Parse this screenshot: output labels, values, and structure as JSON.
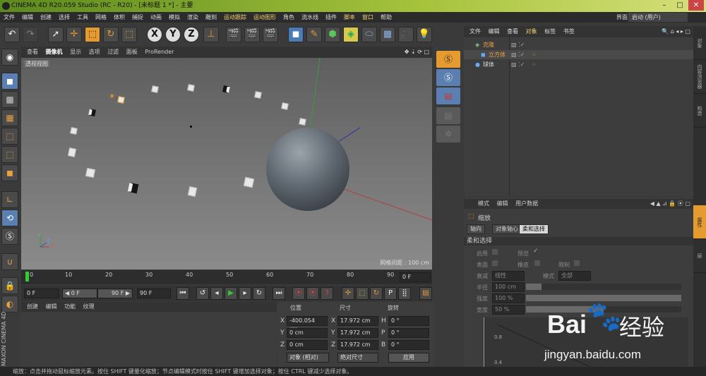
{
  "titlebar": {
    "title": "CINEMA 4D R20.059 Studio (RC - R20) - [未标题 1 *] - 主要",
    "min": "–",
    "max": "□",
    "close": "✕"
  },
  "menu": {
    "items": [
      "文件",
      "编辑",
      "创建",
      "选择",
      "工具",
      "网格",
      "体积",
      "捕捉",
      "动画",
      "模拟",
      "渲染",
      "雕刻",
      "运动跟踪",
      "运动图形",
      "角色",
      "流水线",
      "插件",
      "脚本",
      "窗口",
      "帮助"
    ],
    "layout_label": "界面:",
    "layout_value": "启动 (用户)"
  },
  "toolbar": {
    "x": "X",
    "y": "Y",
    "z": "Z"
  },
  "viewport": {
    "tabs": [
      "查看",
      "摄像机",
      "显示",
      "选项",
      "过滤",
      "面板",
      "ProRender"
    ],
    "label": "透视视图",
    "grid_info": "网格间距 : 100 cm",
    "axis_y": "Y",
    "axis_x": "X",
    "axis_z": "Z"
  },
  "timeline": {
    "ticks": [
      "0",
      "10",
      "20",
      "30",
      "40",
      "50",
      "60",
      "70",
      "80",
      "90"
    ],
    "frame": "0 F"
  },
  "playback": {
    "start": "0 F",
    "current": "◀ 0 F",
    "end_inner": "90 F ▶",
    "end": "90 F"
  },
  "bottom_left": {
    "tabs": [
      "创建",
      "编辑",
      "功能",
      "纹理"
    ]
  },
  "coords": {
    "headers": [
      "位置",
      "尺寸",
      "旋转"
    ],
    "rows": [
      {
        "axis": "X",
        "pos": "-400.054 cm",
        "size_axis": "X",
        "size": "17.972 cm",
        "rot_axis": "H",
        "rot": "0 °"
      },
      {
        "axis": "Y",
        "pos": "0 cm",
        "size_axis": "Y",
        "size": "17.972 cm",
        "rot_axis": "P",
        "rot": "0 °"
      },
      {
        "axis": "Z",
        "pos": "0 cm",
        "size_axis": "Z",
        "size": "17.972 cm",
        "rot_axis": "B",
        "rot": "0 °"
      }
    ],
    "mode": "对象 (相对)",
    "size_mode": "绝对尺寸",
    "apply": "应用"
  },
  "objects": {
    "tabs": [
      "文件",
      "编辑",
      "查看",
      "对象",
      "标签",
      "书签"
    ],
    "items": [
      {
        "name": "克隆"
      },
      {
        "name": "立方体"
      },
      {
        "name": "球体"
      }
    ]
  },
  "attributes": {
    "tabs": [
      "模式",
      "编辑",
      "用户数据"
    ],
    "object_name": "缩放",
    "subtabs": [
      "轴向",
      "对象轴心",
      "柔和选择"
    ],
    "section": "柔和选择",
    "enable": "启用",
    "preview": "预览",
    "surface": "表面",
    "rubber": "橡皮",
    "restrict": "限制",
    "falloff_label": "衰减",
    "falloff": "线性",
    "mode_label": "模式",
    "mode": "全部",
    "radius_label": "半径",
    "radius": "100 cm",
    "radius_fill": 0.1,
    "strength_label": "强度",
    "strength": "100 %",
    "strength_fill": 1.0,
    "width_label": "宽度",
    "width": "50 %",
    "width_fill": 0.5,
    "graph_ticks": [
      "0.8",
      "0.4"
    ]
  },
  "right_strip": [
    "对象",
    "内容浏览器",
    "构造",
    "属性",
    "层"
  ],
  "status": "缩放：点击并拖动鼠标缩放元素。按住 SHIFT 键量化缩放；节点编辑模式时按住 SHIFT 键增加选择对象；按住 CTRL 键减少选择对象。",
  "watermark": {
    "brand": "Bai",
    "brand2": "经验",
    "url": "jingyan.baidu.com"
  }
}
